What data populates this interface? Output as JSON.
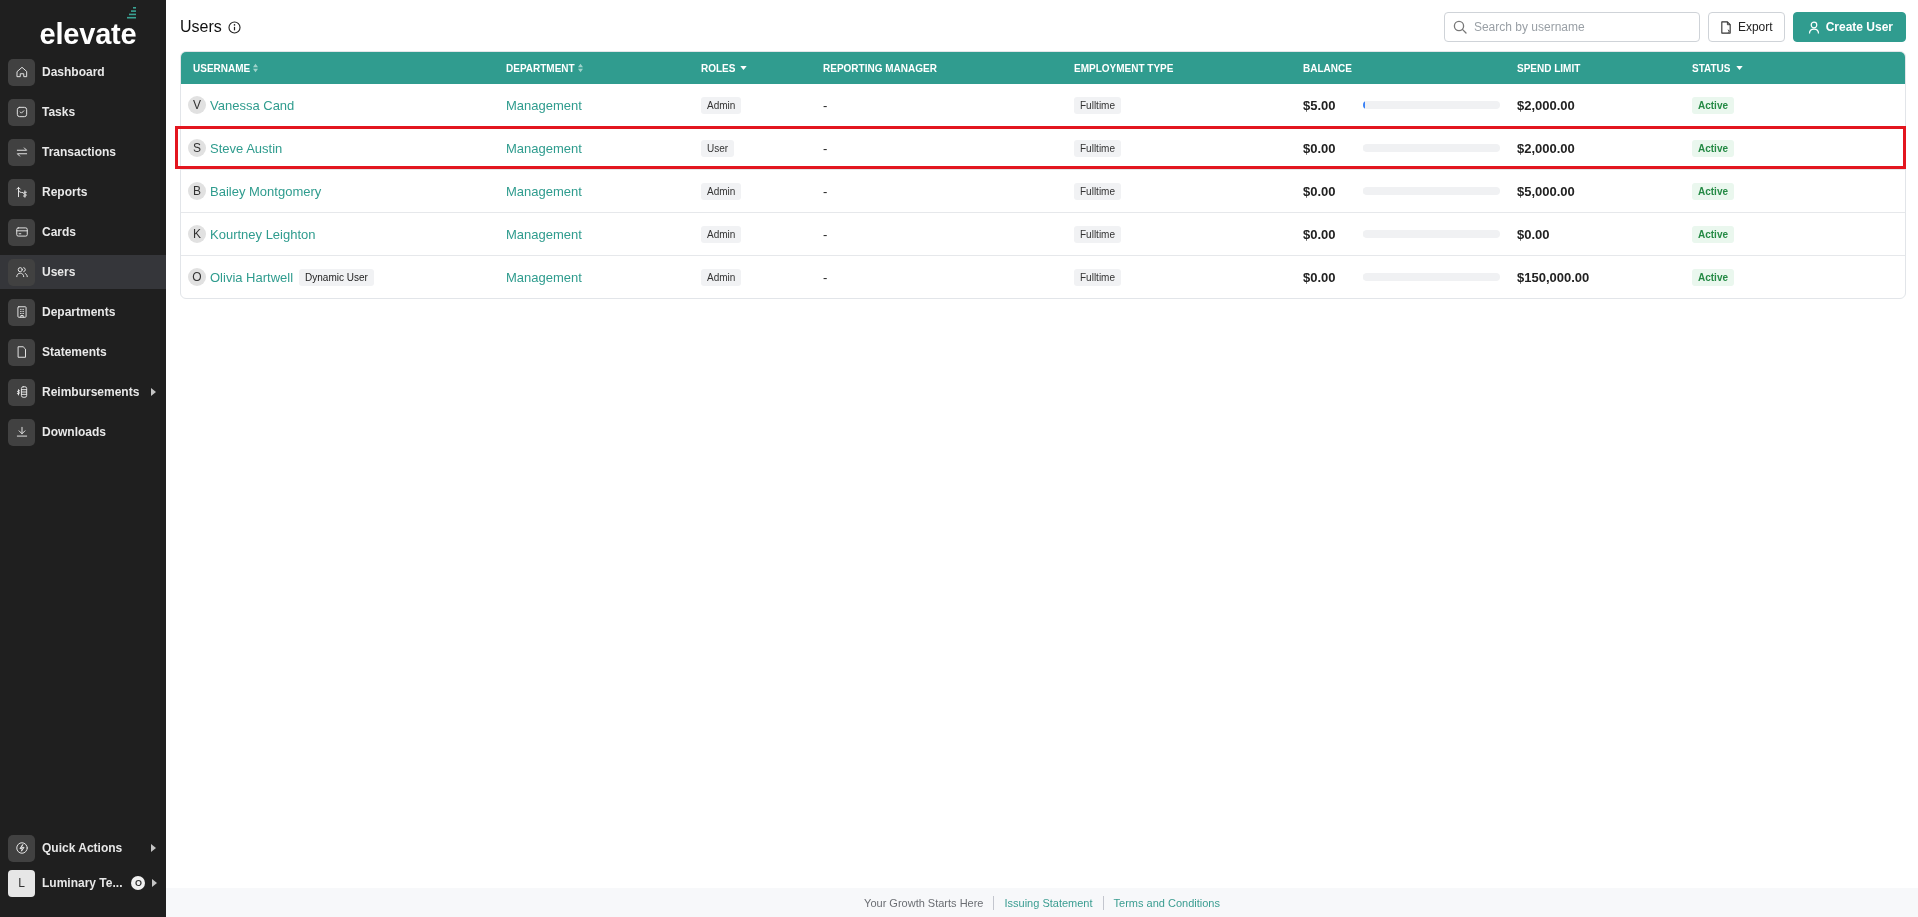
{
  "sidebar": {
    "logo": "elevate",
    "items": [
      {
        "label": "Dashboard",
        "selected": false,
        "has_submenu": false
      },
      {
        "label": "Tasks",
        "selected": false,
        "has_submenu": false
      },
      {
        "label": "Transactions",
        "selected": false,
        "has_submenu": false
      },
      {
        "label": "Reports",
        "selected": false,
        "has_submenu": false
      },
      {
        "label": "Cards",
        "selected": false,
        "has_submenu": false
      },
      {
        "label": "Users",
        "selected": true,
        "has_submenu": false
      },
      {
        "label": "Departments",
        "selected": false,
        "has_submenu": false
      },
      {
        "label": "Statements",
        "selected": false,
        "has_submenu": false
      },
      {
        "label": "Reimbursements",
        "selected": false,
        "has_submenu": true
      },
      {
        "label": "Downloads",
        "selected": false,
        "has_submenu": false
      }
    ],
    "bottom_items": [
      {
        "label": "Quick Actions",
        "has_submenu": true
      }
    ],
    "account": {
      "initial": "L",
      "name": "Luminary Te...",
      "badge": "O",
      "has_submenu": true
    }
  },
  "page": {
    "title": "Users"
  },
  "toolbar": {
    "search": {
      "placeholder": "Search by username"
    },
    "buttons": [
      {
        "kind": "export",
        "label": "Export"
      },
      {
        "kind": "create",
        "label": "Create User"
      }
    ]
  },
  "table": {
    "columns": [
      {
        "label": "USERNAME",
        "sortable": true,
        "filterable": false
      },
      {
        "label": "DEPARTMENT",
        "sortable": true,
        "filterable": false
      },
      {
        "label": "ROLES",
        "sortable": false,
        "filterable": true
      },
      {
        "label": "REPORTING MANAGER",
        "sortable": false,
        "filterable": false
      },
      {
        "label": "EMPLOYMENT TYPE",
        "sortable": false,
        "filterable": false
      },
      {
        "label": "BALANCE",
        "sortable": false,
        "filterable": false
      },
      {
        "label": "SPEND LIMIT",
        "sortable": false,
        "filterable": false
      },
      {
        "label": "STATUS",
        "sortable": false,
        "filterable": true
      }
    ],
    "rows": [
      {
        "initial": "V",
        "username": "Vanessa Cand",
        "department": "Management",
        "role": "Admin",
        "reporting_manager": "-",
        "employment_type": "Fulltime",
        "balance": "$5.00",
        "level": 0.015,
        "spend_limit": "$2,000.00",
        "status": "Active",
        "highlighted": false
      },
      {
        "initial": "S",
        "username": "Steve Austin",
        "department": "Management",
        "role": "User",
        "reporting_manager": "-",
        "employment_type": "Fulltime",
        "balance": "$0.00",
        "level": 0,
        "spend_limit": "$2,000.00",
        "status": "Active",
        "highlighted": true
      },
      {
        "initial": "B",
        "username": "Bailey Montgomery",
        "department": "Management",
        "role": "Admin",
        "reporting_manager": "-",
        "employment_type": "Fulltime",
        "balance": "$0.00",
        "level": 0,
        "spend_limit": "$5,000.00",
        "status": "Active",
        "highlighted": false
      },
      {
        "initial": "K",
        "username": "Kourtney Leighton",
        "department": "Management",
        "role": "Admin",
        "reporting_manager": "-",
        "employment_type": "Fulltime",
        "balance": "$0.00",
        "level": 0,
        "spend_limit": "$0.00",
        "status": "Active",
        "highlighted": false
      },
      {
        "initial": "O",
        "username": "Olivia Hartwell",
        "tag": "Dynamic User",
        "department": "Management",
        "role": "Admin",
        "reporting_manager": "-",
        "employment_type": "Fulltime",
        "balance": "$0.00",
        "level": 0,
        "spend_limit": "$150,000.00",
        "status": "Active",
        "highlighted": false
      }
    ]
  },
  "footer": {
    "items": [
      {
        "kind": "text",
        "label": "Your Growth Starts Here"
      },
      {
        "kind": "link",
        "label": "Issuing Statement"
      },
      {
        "kind": "link",
        "label": "Terms and Conditions"
      }
    ]
  }
}
